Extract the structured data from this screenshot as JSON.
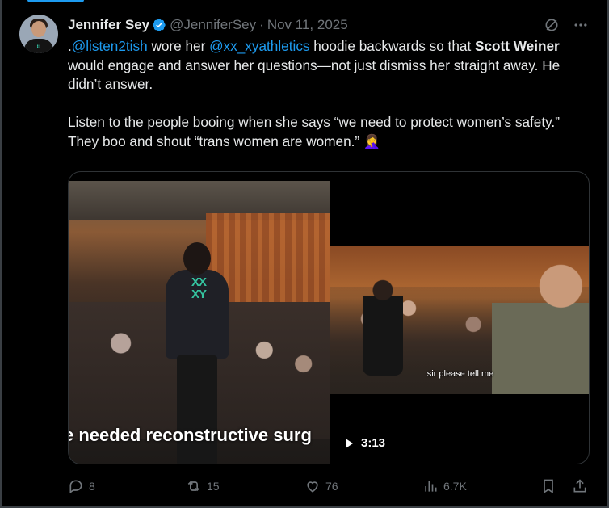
{
  "tweet": {
    "author_name": "Jennifer Sey",
    "handle": "@JenniferSey",
    "separator": "·",
    "date": "Nov 11, 2025",
    "paragraph1_part1": ".",
    "mention1": "@listen2tish",
    "paragraph1_part2": " wore her ",
    "mention2": "@xx_xyathletics",
    "paragraph1_part3": " hoodie backwards so that ",
    "bold_name": "Scott Weiner",
    "paragraph1_part4": " would engage and answer her questions—not just dismiss her straight away. He didn’t answer.",
    "paragraph2": "Listen to the people booing when she says “we need to protect women’s safety.” They boo and shout “trans women are women.” 🤦‍♀️"
  },
  "media": {
    "left_caption": "e needed reconstructive surg",
    "right_caption": "sir please tell me",
    "duration": "3:13",
    "hoodie_logo": "XX XY"
  },
  "actions": {
    "replies": "8",
    "reposts": "15",
    "likes": "76",
    "views": "6.7K"
  },
  "icons": {
    "verified": "verified-badge-icon",
    "grok": "grok-icon",
    "more": "more-icon",
    "reply": "reply-icon",
    "repost": "repost-icon",
    "like": "heart-icon",
    "views": "views-icon",
    "bookmark": "bookmark-icon",
    "share": "share-icon"
  },
  "colors": {
    "accent": "#1d9bf0",
    "muted": "#71767b",
    "text": "#e7e9ea",
    "background": "#000000"
  }
}
